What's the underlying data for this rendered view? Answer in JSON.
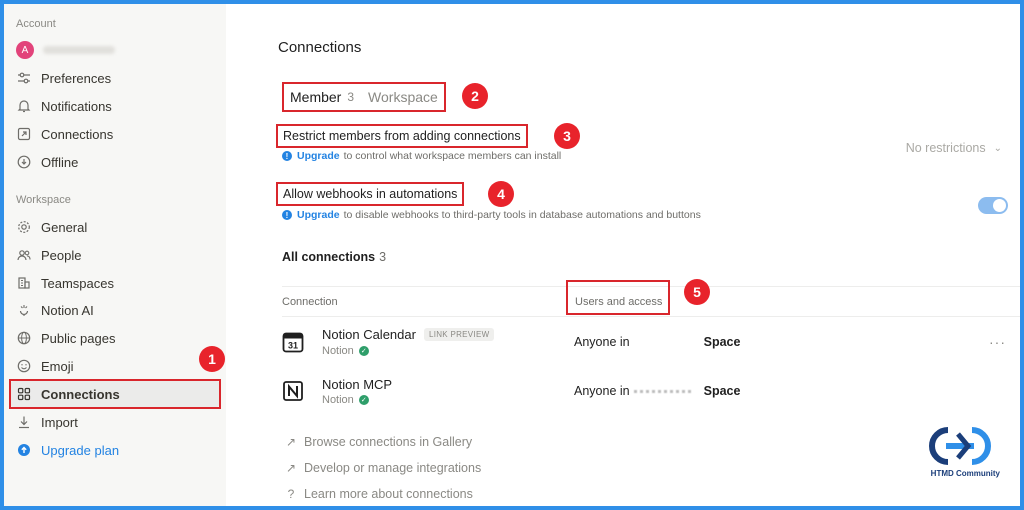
{
  "sidebar": {
    "account_label": "Account",
    "avatar_letter": "A",
    "account_items": [
      {
        "label": "Preferences",
        "icon": "sliders-icon"
      },
      {
        "label": "Notifications",
        "icon": "bell-icon"
      },
      {
        "label": "Connections",
        "icon": "connections-box-icon"
      },
      {
        "label": "Offline",
        "icon": "download-circle-icon"
      }
    ],
    "workspace_label": "Workspace",
    "workspace_items": [
      {
        "label": "General",
        "icon": "gear-icon"
      },
      {
        "label": "People",
        "icon": "people-icon"
      },
      {
        "label": "Teamspaces",
        "icon": "building-icon"
      },
      {
        "label": "Notion AI",
        "icon": "sparkle-face-icon"
      },
      {
        "label": "Public pages",
        "icon": "globe-icon"
      },
      {
        "label": "Emoji",
        "icon": "smile-icon"
      },
      {
        "label": "Connections",
        "icon": "grid-icon"
      },
      {
        "label": "Import",
        "icon": "import-icon"
      },
      {
        "label": "Upgrade plan",
        "icon": "upgrade-arrow-icon"
      }
    ]
  },
  "main": {
    "title": "Connections",
    "tabs": {
      "member": "Member",
      "member_count": "3",
      "workspace": "Workspace"
    },
    "restrict": {
      "title": "Restrict members from adding connections",
      "upgrade": "Upgrade",
      "desc": "to control what workspace members can install",
      "select_value": "No restrictions"
    },
    "webhooks": {
      "title": "Allow webhooks in automations",
      "upgrade": "Upgrade",
      "desc": "to disable webhooks to third-party tools in database automations and buttons",
      "toggle_on": true
    },
    "all_connections": {
      "label": "All connections",
      "count": "3"
    },
    "table": {
      "col_connection": "Connection",
      "col_access": "Users and access",
      "rows": [
        {
          "name": "Notion Calendar",
          "badge": "LINK PREVIEW",
          "publisher": "Notion",
          "access_prefix": "Anyone in",
          "access_suffix": "Space"
        },
        {
          "name": "Notion MCP",
          "badge": "",
          "publisher": "Notion",
          "access_prefix": "Anyone in",
          "access_suffix": "Space"
        }
      ]
    },
    "footer_links": [
      {
        "label": "Browse connections in Gallery",
        "icon": "arrow-up-right-icon"
      },
      {
        "label": "Develop or manage integrations",
        "icon": "arrow-up-right-icon"
      },
      {
        "label": "Learn more about connections",
        "icon": "question-circle-icon"
      }
    ],
    "more_label": "···"
  },
  "annotations": [
    "1",
    "2",
    "3",
    "4",
    "5"
  ],
  "watermark": {
    "text": "HTMD Community"
  },
  "colors": {
    "accent_blue": "#2383e2",
    "annotation_red": "#e8232b",
    "frame_blue": "#2f8fe8"
  }
}
